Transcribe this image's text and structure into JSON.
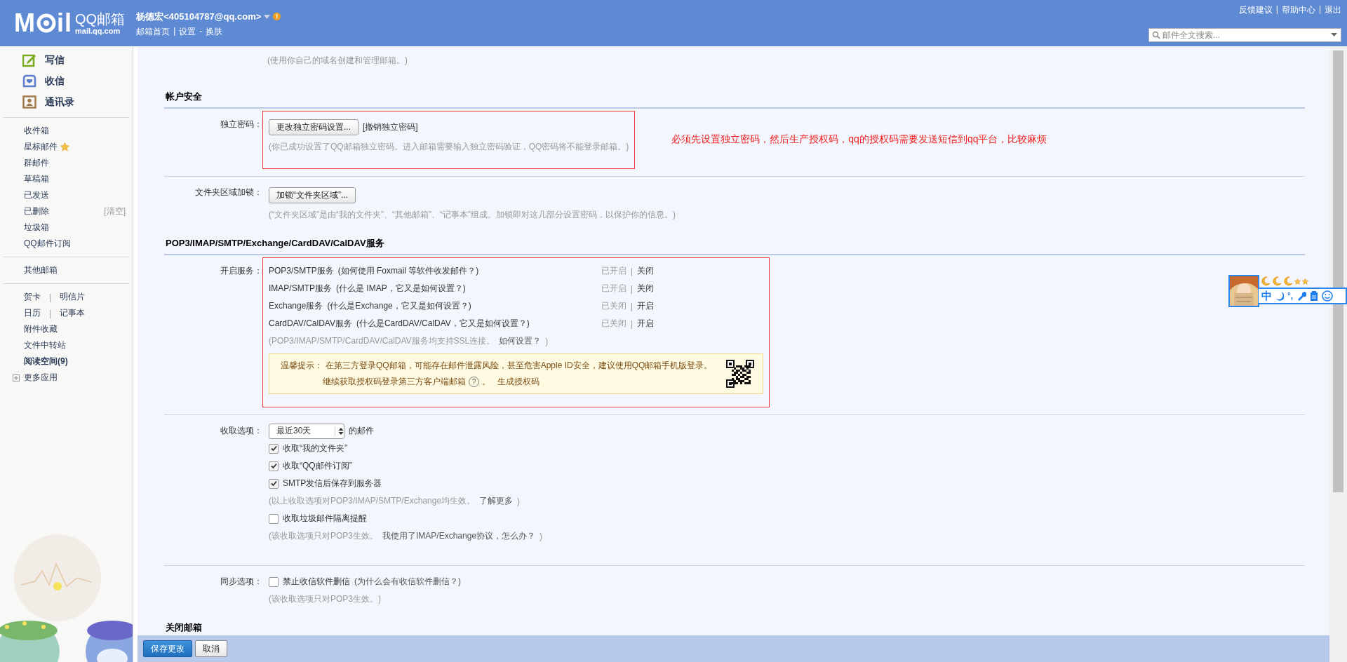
{
  "header": {
    "logo": {
      "before": "M",
      "after": "il",
      "title": "QQ邮箱",
      "domain": "mail.qq.com"
    },
    "user": {
      "name": "杨德宏<405104787@qq.com>",
      "alert": "!"
    },
    "nav": {
      "items": [
        "邮箱首页",
        "设置",
        "换肤"
      ],
      "separators": [
        "|",
        "-"
      ]
    },
    "top_links": {
      "items": [
        "反馈建议",
        "帮助中心",
        "退出"
      ],
      "separator": "|"
    },
    "search": {
      "placeholder": "邮件全文搜索..."
    }
  },
  "sidebar": {
    "actions": [
      {
        "label": "写信"
      },
      {
        "label": "收信"
      },
      {
        "label": "通讯录"
      }
    ],
    "groups": [
      [
        {
          "kind": "link",
          "label": "收件箱"
        },
        {
          "kind": "starred",
          "label": "星标邮件"
        },
        {
          "kind": "link",
          "label": "群邮件"
        },
        {
          "kind": "link",
          "label": "草稿箱"
        },
        {
          "kind": "link",
          "label": "已发送"
        },
        {
          "kind": "link",
          "label": "已删除",
          "extra": "[清空]"
        },
        {
          "kind": "link",
          "label": "垃圾箱"
        },
        {
          "kind": "link",
          "label": "QQ邮件订阅"
        }
      ],
      [
        {
          "kind": "link",
          "label": "其他邮箱"
        }
      ],
      [
        {
          "kind": "pair",
          "labels": [
            "贺卡",
            "明信片"
          ],
          "separator": "|"
        },
        {
          "kind": "pair",
          "labels": [
            "日历",
            "记事本"
          ],
          "separator": "|"
        },
        {
          "kind": "link",
          "label": "附件收藏"
        },
        {
          "kind": "link",
          "label": "文件中转站"
        },
        {
          "kind": "link",
          "label": "阅读空间(9)",
          "bold": true
        },
        {
          "kind": "expand",
          "label": "更多应用"
        }
      ]
    ]
  },
  "settings": {
    "sections": [
      {
        "kind": "lead_note",
        "text": "(使用你自己的域名创建和管理邮箱。)"
      },
      {
        "kind": "heading",
        "title": "帐户安全",
        "rule_after": true
      },
      {
        "kind": "row",
        "label": "独立密码：",
        "boxed": true,
        "rule_after": true,
        "annotation": "必须先设置独立密码，然后生产授权码，qq的授权码需要发送短信到qq平台，比较麻烦",
        "lines": [
          {
            "kind": "actions",
            "button": "更改独立密码设置...",
            "link": "[撤销独立密码]"
          },
          {
            "kind": "note",
            "text": "(你已成功设置了QQ邮箱独立密码。进入邮箱需要输入独立密码验证，QQ密码将不能登录邮箱。)"
          }
        ]
      },
      {
        "kind": "row",
        "label": "文件夹区域加锁：",
        "boxed": false,
        "rule_after": false,
        "lines": [
          {
            "kind": "actions",
            "button": "加锁“文件夹区域”..."
          },
          {
            "kind": "note",
            "text": "(“文件夹区域”是由“我的文件夹”、“其他邮箱”、“记事本”组成。加锁即对这几部分设置密码，以保护你的信息。)"
          }
        ]
      },
      {
        "kind": "heading",
        "title": "POP3/IMAP/SMTP/Exchange/CardDAV/CalDAV服务",
        "rule_after": true
      },
      {
        "kind": "row",
        "label": "开启服务：",
        "boxed": true,
        "rule_after": true,
        "lines": [
          {
            "kind": "service",
            "name": "POP3/SMTP服务",
            "help": "(如何使用 Foxmail 等软件收发邮件？)",
            "status": "已开启",
            "separator": "|",
            "action": "关闭"
          },
          {
            "kind": "service",
            "name": "IMAP/SMTP服务",
            "help": "(什么是 IMAP，它又是如何设置？)",
            "status": "已开启",
            "separator": "|",
            "action": "关闭"
          },
          {
            "kind": "service",
            "name": "Exchange服务",
            "help": "(什么是Exchange，它又是如何设置？)",
            "status": "已关闭",
            "separator": "|",
            "action": "开启"
          },
          {
            "kind": "service",
            "name": "CardDAV/CalDAV服务",
            "help": "(什么是CardDAV/CalDAV，它又是如何设置？)",
            "status": "已关闭",
            "separator": "|",
            "action": "开启"
          },
          {
            "kind": "note",
            "text": "(POP3/IMAP/SMTP/CardDAV/CalDAV服务均支持SSL连接。",
            "link": "如何设置？",
            "after": ")"
          },
          {
            "kind": "tip",
            "label": "温馨提示：",
            "text": "在第三方登录QQ邮箱，可能存在邮件泄露风险，甚至危害Apple ID安全，建议使用QQ邮箱手机版登录。",
            "line2": "继续获取授权码登录第三方客户端邮箱",
            "help": "?",
            "line2_end": "。",
            "link": "生成授权码"
          }
        ]
      },
      {
        "kind": "row",
        "label": "收取选项：",
        "boxed": false,
        "rule_after": true,
        "lines": [
          {
            "kind": "select",
            "value": "最近30天",
            "after": "的邮件"
          },
          {
            "kind": "checkbox",
            "label": "收取“我的文件夹”",
            "checked": true
          },
          {
            "kind": "checkbox",
            "label": "收取“QQ邮件订阅”",
            "checked": true
          },
          {
            "kind": "checkbox",
            "label": "SMTP发信后保存到服务器",
            "checked": true
          },
          {
            "kind": "note",
            "text": "(以上收取选项对POP3/IMAP/SMTP/Exchange均生效。",
            "link": "了解更多",
            "after": ")"
          },
          {
            "kind": "checkbox",
            "label": "收取垃圾邮件隔离提醒",
            "checked": false
          },
          {
            "kind": "note",
            "text": "(该收取选项只对POP3生效。",
            "link": "我使用了IMAP/Exchange协议，怎么办？",
            "after": ")"
          }
        ]
      },
      {
        "kind": "row",
        "label": "同步选项：",
        "boxed": false,
        "rule_after": false,
        "lines": [
          {
            "kind": "checkbox",
            "label": "禁止收信软件删信",
            "checked": false,
            "help": "(为什么会有收信软件删信？)"
          },
          {
            "kind": "note",
            "text": "(该收取选项只对POP3生效。)"
          }
        ]
      },
      {
        "kind": "heading",
        "title": "关闭邮箱",
        "rule_after": false
      }
    ]
  },
  "footer": {
    "buttons": [
      {
        "label": "保存更改",
        "primary": true
      },
      {
        "label": "取消",
        "primary": false
      }
    ]
  },
  "ime": {
    "mode": "中",
    "punctuation": "°,"
  }
}
